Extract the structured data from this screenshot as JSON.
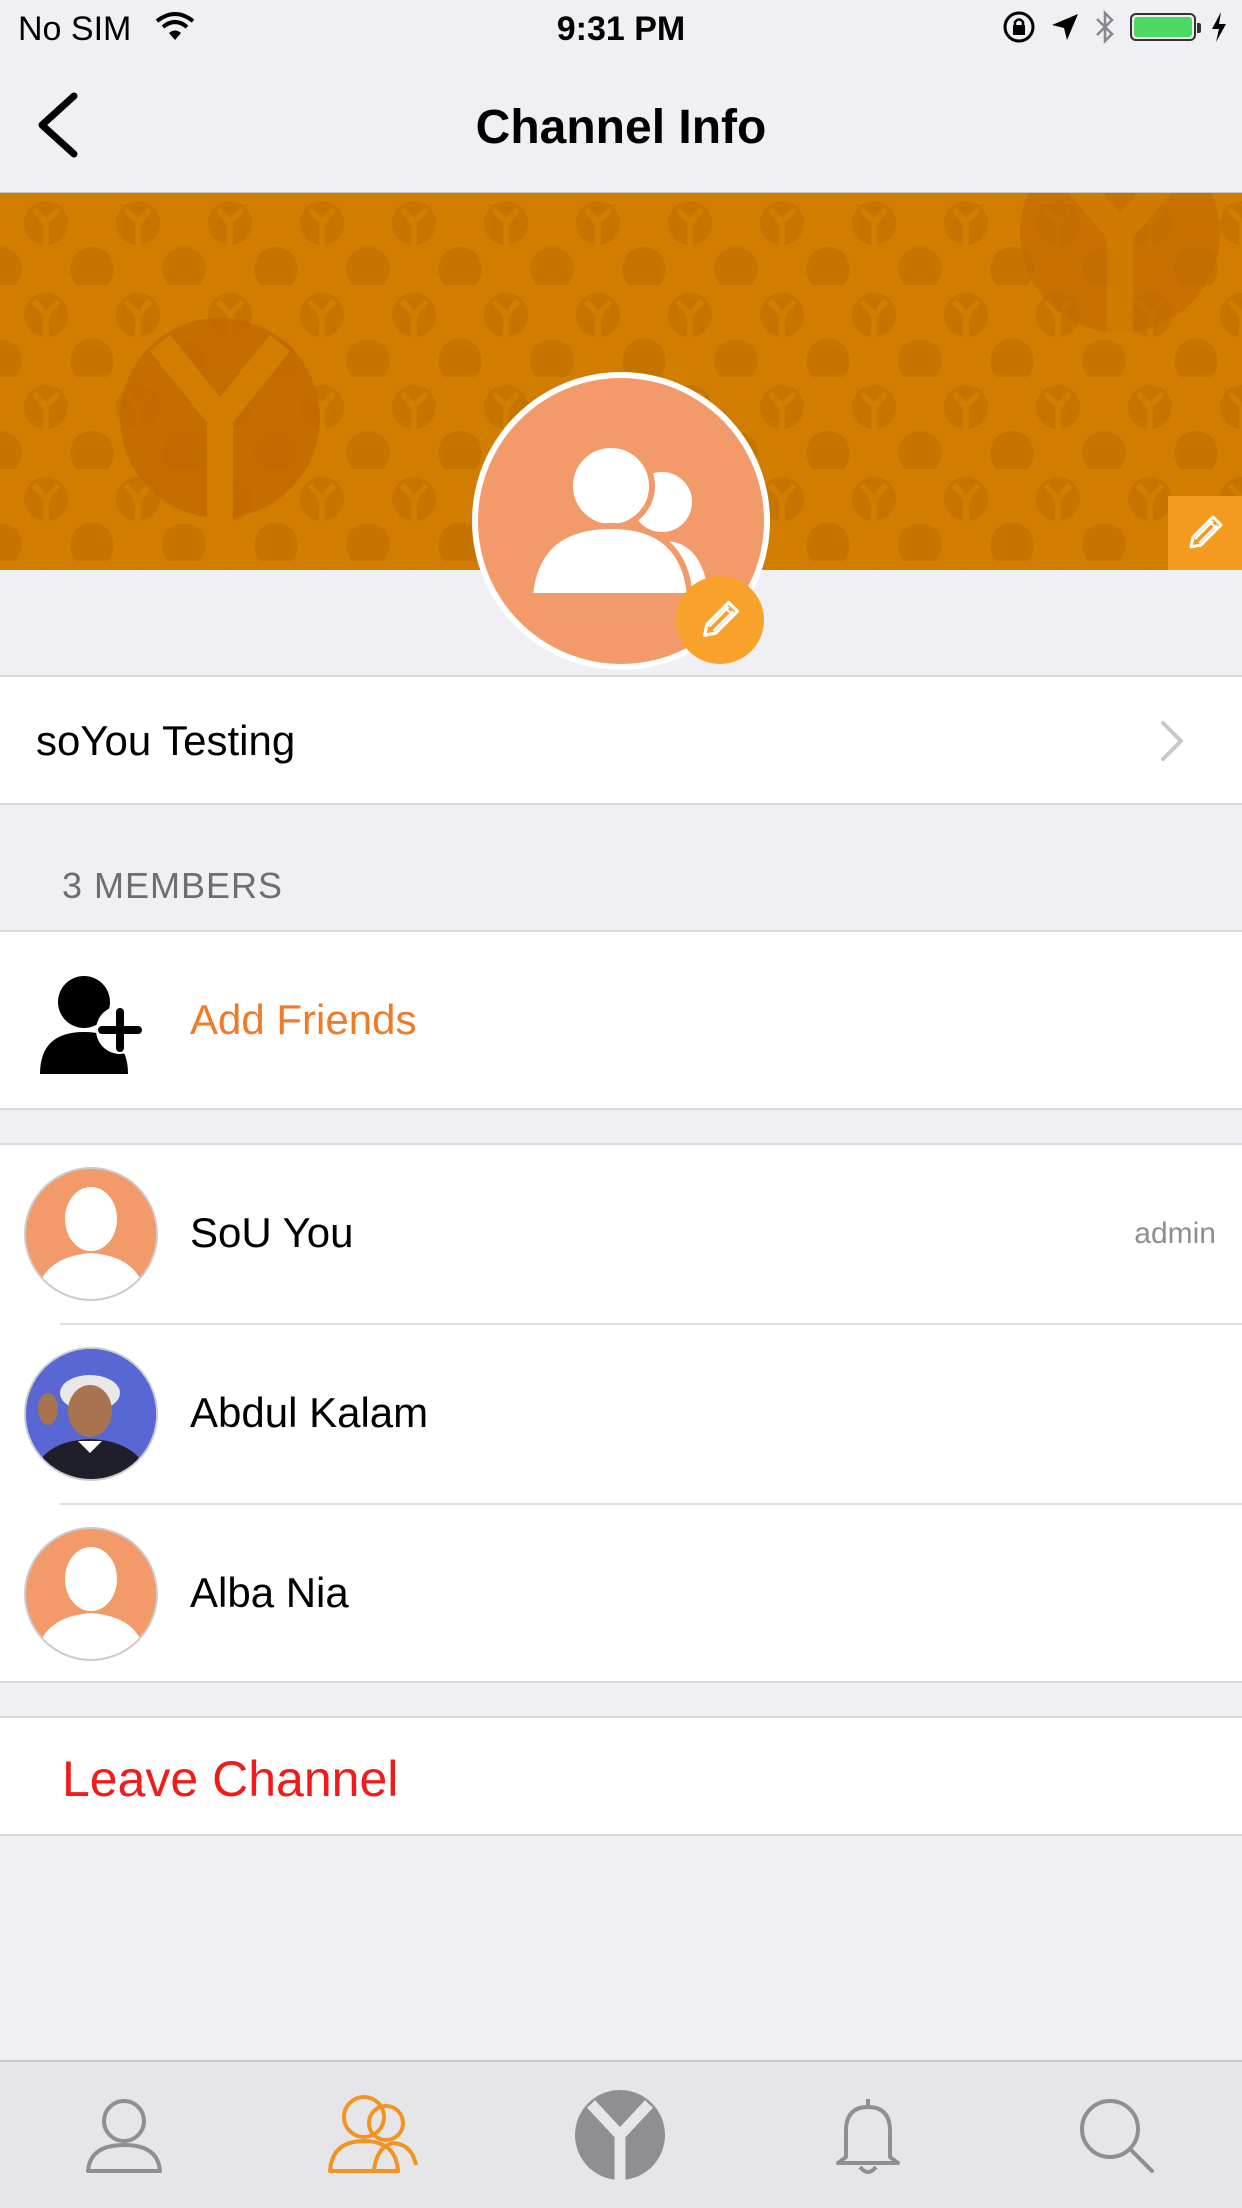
{
  "status_bar": {
    "carrier": "No SIM",
    "time": "9:31 PM"
  },
  "nav": {
    "title": "Channel Info"
  },
  "channel": {
    "name": "soYou Testing"
  },
  "members_section": {
    "header": "3 MEMBERS",
    "add_label": "Add Friends"
  },
  "members": [
    {
      "name": "SoU You",
      "role": "admin",
      "avatar": "default-person-icon"
    },
    {
      "name": "Abdul Kalam",
      "role": "",
      "avatar": "photo"
    },
    {
      "name": "Alba Nia",
      "role": "",
      "avatar": "default-person-icon"
    }
  ],
  "actions": {
    "leave_label": "Leave Channel"
  },
  "tab_bar": {
    "tabs": [
      {
        "icon": "profile-icon",
        "active": false
      },
      {
        "icon": "group-icon",
        "active": true
      },
      {
        "icon": "soyou-logo-icon",
        "active": false
      },
      {
        "icon": "bell-icon",
        "active": false
      },
      {
        "icon": "search-icon",
        "active": false
      }
    ]
  },
  "colors": {
    "accent": "#f07a26",
    "cover": "#d17d00",
    "destructive": "#f21b1b",
    "avatar_bg": "#f39a6b"
  }
}
